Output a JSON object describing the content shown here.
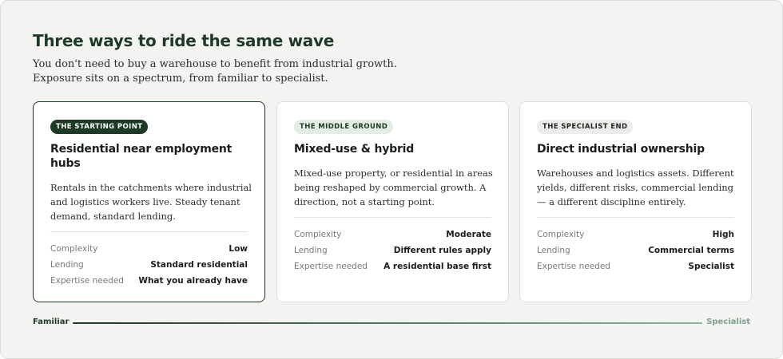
{
  "header": {
    "title": "Three ways to ride the same wave",
    "intro": "You don't need to buy a warehouse to benefit from industrial growth. Exposure sits on a spectrum, from familiar to specialist."
  },
  "cards": [
    {
      "badge": "THE STARTING POINT",
      "title": "Residential near employment hubs",
      "description": "Rentals in the catchments where industrial and logistics workers live. Steady tenant demand, standard lending.",
      "selected": true,
      "rows": [
        {
          "label": "Complexity",
          "value": "Low"
        },
        {
          "label": "Lending",
          "value": "Standard residential"
        },
        {
          "label": "Expertise needed",
          "value": "What you already have"
        }
      ]
    },
    {
      "badge": "THE MIDDLE GROUND",
      "title": "Mixed-use & hybrid",
      "description": "Mixed-use property, or residential in areas being reshaped by commercial growth. A direction, not a starting point.",
      "selected": false,
      "rows": [
        {
          "label": "Complexity",
          "value": "Moderate"
        },
        {
          "label": "Lending",
          "value": "Different rules apply"
        },
        {
          "label": "Expertise needed",
          "value": "A residential base first"
        }
      ]
    },
    {
      "badge": "THE SPECIALIST END",
      "title": "Direct industrial ownership",
      "description": "Warehouses and logistics assets. Different yields, different risks, commercial lending — a different discipline entirely.",
      "selected": false,
      "rows": [
        {
          "label": "Complexity",
          "value": "High"
        },
        {
          "label": "Lending",
          "value": "Commercial terms"
        },
        {
          "label": "Expertise needed",
          "value": "Specialist"
        }
      ]
    }
  ],
  "scale": {
    "left_label": "Familiar",
    "right_label": "Specialist"
  },
  "colors": {
    "brand_dark_green": "#1d3a26",
    "light_green_badge": "#e4ede3",
    "gray_badge": "#ececea",
    "scale_end": "#8fb59b",
    "background": "#f3f3f1"
  }
}
